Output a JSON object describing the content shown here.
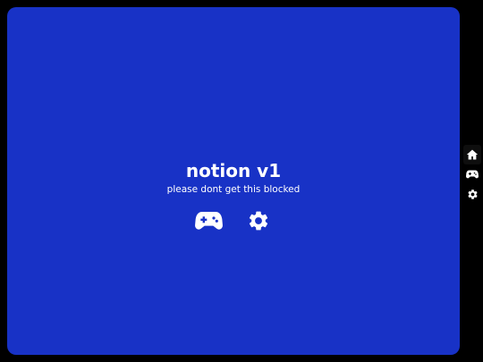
{
  "app": {
    "title": "notion v1",
    "subtitle": "please dont get this blocked"
  },
  "main_actions": [
    {
      "name": "games",
      "icon": "gamepad-icon"
    },
    {
      "name": "settings",
      "icon": "gear-icon"
    }
  ],
  "sidebar": {
    "items": [
      {
        "name": "home",
        "icon": "home-icon",
        "active": true
      },
      {
        "name": "games",
        "icon": "gamepad-icon",
        "active": false
      },
      {
        "name": "settings",
        "icon": "gear-icon",
        "active": false
      }
    ]
  },
  "colors": {
    "background": "#000000",
    "panel": "#1832c6",
    "text": "#ffffff"
  }
}
